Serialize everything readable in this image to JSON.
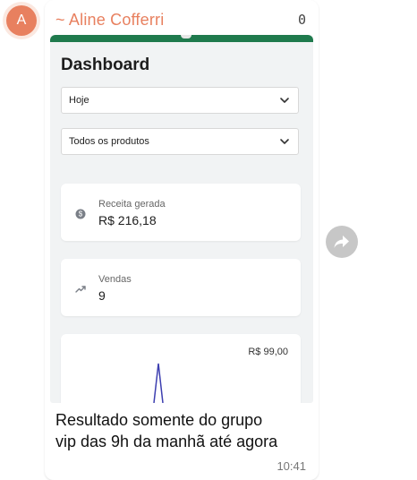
{
  "chat": {
    "avatar_letter": "A",
    "sender_name": "~ Aline Cofferri",
    "sender_phone_fragment": "0",
    "caption_line1": "Resultado somente do grupo",
    "caption_line2": "vip das 9h da manhã até agora",
    "time": "10:41",
    "forward_icon": "forward-icon"
  },
  "dashboard": {
    "title": "Dashboard",
    "period_select": "Hoje",
    "product_select": "Todos os produtos",
    "revenue": {
      "label": "Receita gerada",
      "value": "R$  216,18",
      "icon": "coin-icon"
    },
    "sales": {
      "label": "Vendas",
      "value": "9",
      "icon": "trending-up-icon"
    },
    "chart_value_label": "R$  99,00"
  },
  "colors": {
    "brand_green": "#1f7a4d",
    "sender_orange": "#e8805f",
    "chart_line": "#3d3fb0"
  }
}
